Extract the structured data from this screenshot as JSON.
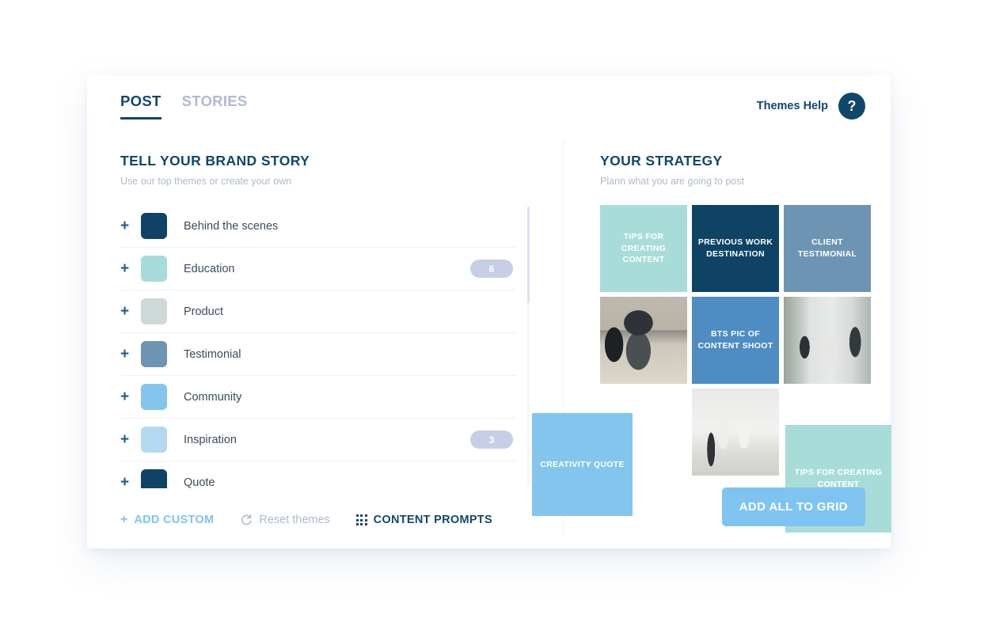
{
  "tabs": [
    {
      "label": "POST",
      "active": true
    },
    {
      "label": "STORIES",
      "active": false
    }
  ],
  "header": {
    "help_label": "Themes Help",
    "help_icon_glyph": "?",
    "help_icon_name": "question-mark-icon"
  },
  "left_panel": {
    "title": "TELL YOUR BRAND STORY",
    "subtitle": "Use our top themes or create your own",
    "themes": [
      {
        "name": "Behind the scenes",
        "color": "#0E4366",
        "count": ""
      },
      {
        "name": "Education",
        "color": "#A8DCD9",
        "count": "6"
      },
      {
        "name": "Product",
        "color": "#CDD8D8",
        "count": ""
      },
      {
        "name": "Testimonial",
        "color": "#6D94B2",
        "count": ""
      },
      {
        "name": "Community",
        "color": "#84C5EE",
        "count": ""
      },
      {
        "name": "Inspiration",
        "color": "#B4D8F0",
        "count": "3"
      },
      {
        "name": "Quote",
        "color": "#0E4366",
        "count": ""
      }
    ],
    "actions": {
      "add_custom": {
        "label": "ADD CUSTOM",
        "glyph": "+"
      },
      "reset": {
        "label": "Reset themes",
        "icon": "refresh-icon"
      },
      "content_prompts": {
        "label": "CONTENT PROMPTS",
        "icon": "grid-dots-icon"
      }
    }
  },
  "right_panel": {
    "title": "YOUR STRATEGY",
    "subtitle": "Plann what you are going to post",
    "grid": [
      {
        "type": "label",
        "label": "TIPS FOR CREATING CONTENT",
        "color": "#A8DCD9"
      },
      {
        "type": "label",
        "label": "PREVIOUS WORK DESTINATION",
        "color": "#0E4366"
      },
      {
        "type": "label",
        "label": "CLIENT TESTIMONIAL",
        "color": "#6D94B2"
      },
      {
        "type": "photo",
        "label": "",
        "color": "#b9b3a6"
      },
      {
        "type": "label",
        "label": "BTS PIC OF CONTENT SHOOT",
        "color": "#4E8CC4"
      },
      {
        "type": "photo",
        "label": "",
        "color": "#d6dad8"
      },
      {
        "type": "empty",
        "label": "",
        "color": "#ffffff"
      },
      {
        "type": "photo",
        "label": "",
        "color": "#e9e9e7"
      },
      {
        "type": "empty",
        "label": "",
        "color": "#ffffff"
      }
    ],
    "overlays": [
      {
        "label": "CREATIVITY QUOTE",
        "color": "#84C5EE"
      },
      {
        "label": "TIPS FOR CREATING CONTENT",
        "color": "#A8DCD9"
      }
    ],
    "add_all_label": "ADD ALL TO GRID"
  },
  "colors": {
    "navy": "#11476B",
    "sky": "#7FC4F0",
    "mint": "#A8DCD9",
    "muted": "#AEBACB",
    "badge": "#C6CFE6"
  }
}
